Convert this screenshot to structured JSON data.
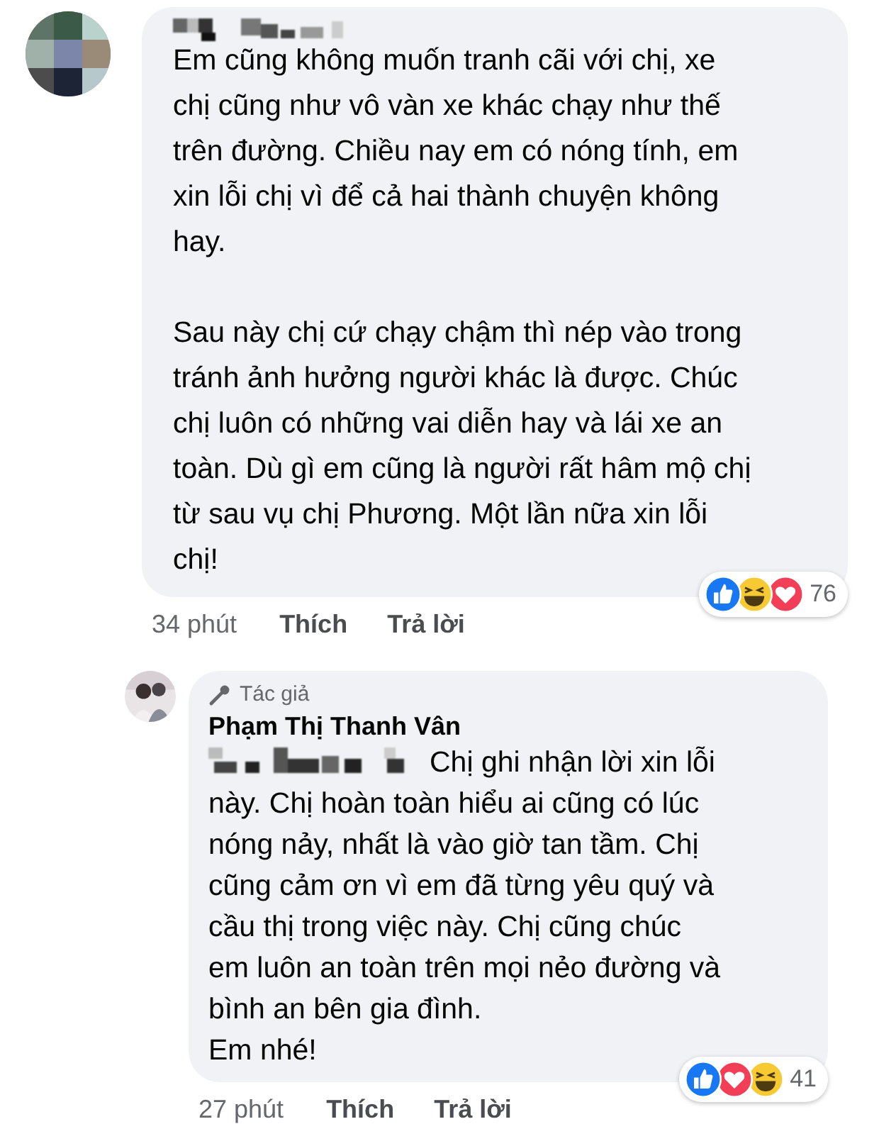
{
  "comments": [
    {
      "author_name_pixelated": true,
      "mention_pixelated": false,
      "paragraphs": [
        [
          "Em cũng không muốn tranh cãi với chị, xe",
          "chị cũng như vô vàn xe khác chạy như thế",
          "trên đường. Chiều nay em có nóng tính, em",
          "xin lỗi chị vì để cả hai thành chuyện không",
          "hay."
        ],
        [
          "Sau này chị cứ chạy chậm thì nép vào trong",
          "tránh ảnh hưởng người khác là được. Chúc",
          "chị luôn có những vai diễn hay và lái xe an",
          "toàn. Dù gì em cũng là người rất hâm mộ chị",
          "từ sau vụ chị Phương. Một lần nữa xin lỗi",
          "chị!"
        ]
      ],
      "time": "34 phút",
      "like": "Thích",
      "reply": "Trả lời",
      "reactions": [
        {
          "kind": "like"
        },
        {
          "kind": "haha"
        },
        {
          "kind": "love"
        }
      ],
      "reaction_count": "76",
      "reply_level": false
    },
    {
      "author_name_pixelated": false,
      "author_badge": "Tác giả",
      "author_name": "Phạm Thị Thanh Vân",
      "mention_pixelated": true,
      "paragraphs": [
        [
          "Chị ghi nhận lời xin lỗi",
          "này. Chị hoàn toàn hiểu ai cũng có lúc",
          "nóng nảy, nhất là vào giờ tan tầm. Chị",
          "cũng cảm ơn vì em đã từng yêu quý và",
          "cầu thị trong việc này. Chị cũng chúc",
          "em luôn an toàn trên mọi nẻo đường và",
          "bình an bên gia đình.",
          "Em nhé!"
        ]
      ],
      "time": "27 phút",
      "like": "Thích",
      "reply": "Trả lời",
      "reactions": [
        {
          "kind": "like"
        },
        {
          "kind": "love"
        },
        {
          "kind": "haha"
        }
      ],
      "reaction_count": "41",
      "reply_level": true
    }
  ]
}
